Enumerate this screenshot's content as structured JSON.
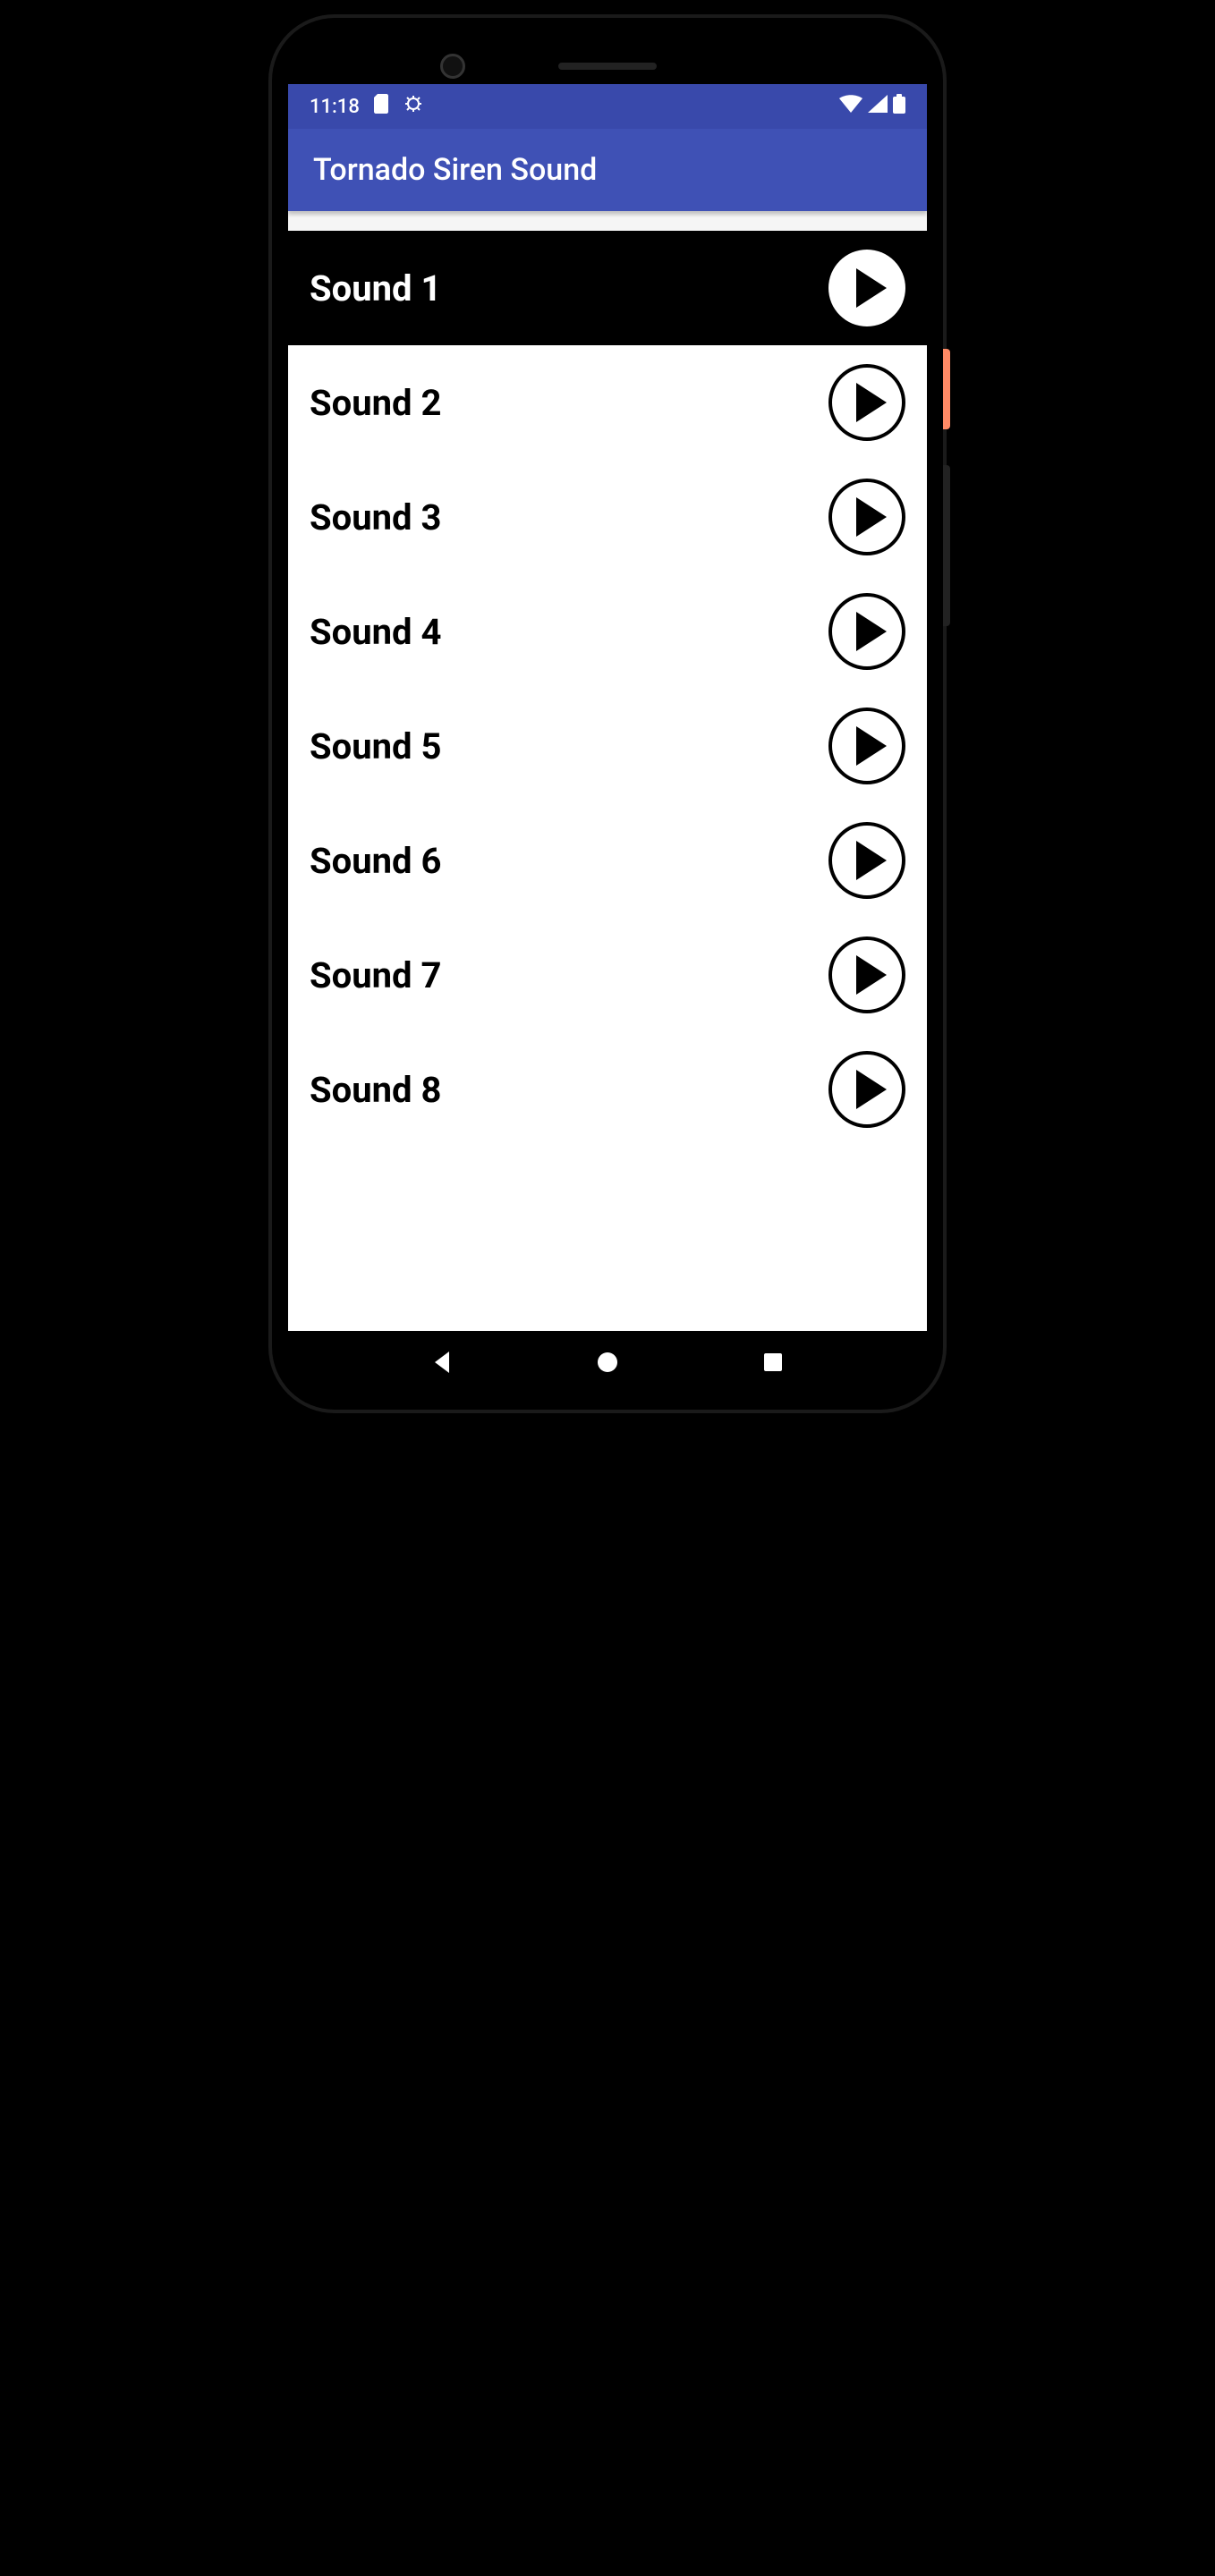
{
  "status": {
    "time": "11:18"
  },
  "app": {
    "title": "Tornado Siren Sound"
  },
  "sounds": [
    {
      "label": "Sound 1",
      "selected": true
    },
    {
      "label": "Sound 2",
      "selected": false
    },
    {
      "label": "Sound 3",
      "selected": false
    },
    {
      "label": "Sound 4",
      "selected": false
    },
    {
      "label": "Sound 5",
      "selected": false
    },
    {
      "label": "Sound 6",
      "selected": false
    },
    {
      "label": "Sound 7",
      "selected": false
    },
    {
      "label": "Sound 8",
      "selected": false
    }
  ]
}
